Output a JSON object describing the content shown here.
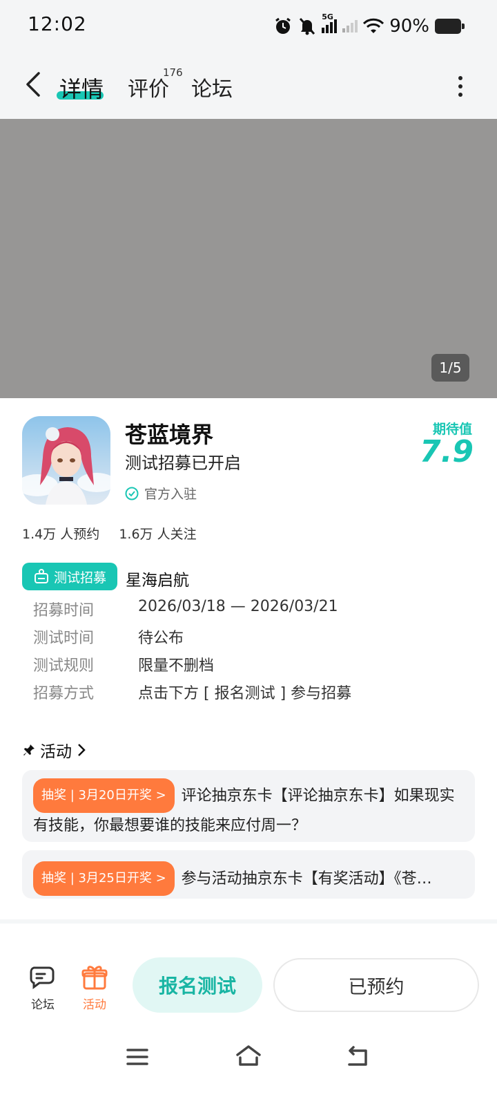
{
  "status_bar": {
    "time": "12:02",
    "network": "5G",
    "battery": "90%"
  },
  "nav": {
    "tabs": [
      {
        "label": "详情"
      },
      {
        "label": "评价"
      },
      {
        "label": "论坛"
      }
    ],
    "review_count": "176"
  },
  "media": {
    "indicator": "1/5"
  },
  "app": {
    "name": "苍蓝境界",
    "subtitle": "测试招募已开启",
    "verified": "官方入驻",
    "expectation_label": "期待值",
    "expectation_score": "7.9",
    "reservations": "1.4万 人预约",
    "followers": "1.6万 人关注"
  },
  "recruit": {
    "badge": "测试招募",
    "title": "星海启航",
    "rows": [
      {
        "label": "招募时间",
        "value": "2026/03/18 — 2026/03/21"
      },
      {
        "label": "测试时间",
        "value": "待公布"
      },
      {
        "label": "测试规则",
        "value": "限量不删档"
      },
      {
        "label": "招募方式",
        "value": "点击下方 [ 报名测试 ] 参与招募"
      }
    ]
  },
  "activities": {
    "header": "活动",
    "items": [
      {
        "tag": "抽奖 | 3月20日开奖 >",
        "text": "评论抽京东卡【评论抽京东卡】如果现实有技能，你最想要谁的技能来应付周一？"
      },
      {
        "tag": "抽奖 | 3月25日开奖 >",
        "text": "参与活动抽京东卡【有奖活动】《苍…"
      }
    ]
  },
  "bottom_bar": {
    "forum_label": "论坛",
    "activity_label": "活动",
    "signup_label": "报名测试",
    "reserved_label": "已预约"
  },
  "colors": {
    "accent": "#19c6b4",
    "orange": "#ff7a3d"
  }
}
